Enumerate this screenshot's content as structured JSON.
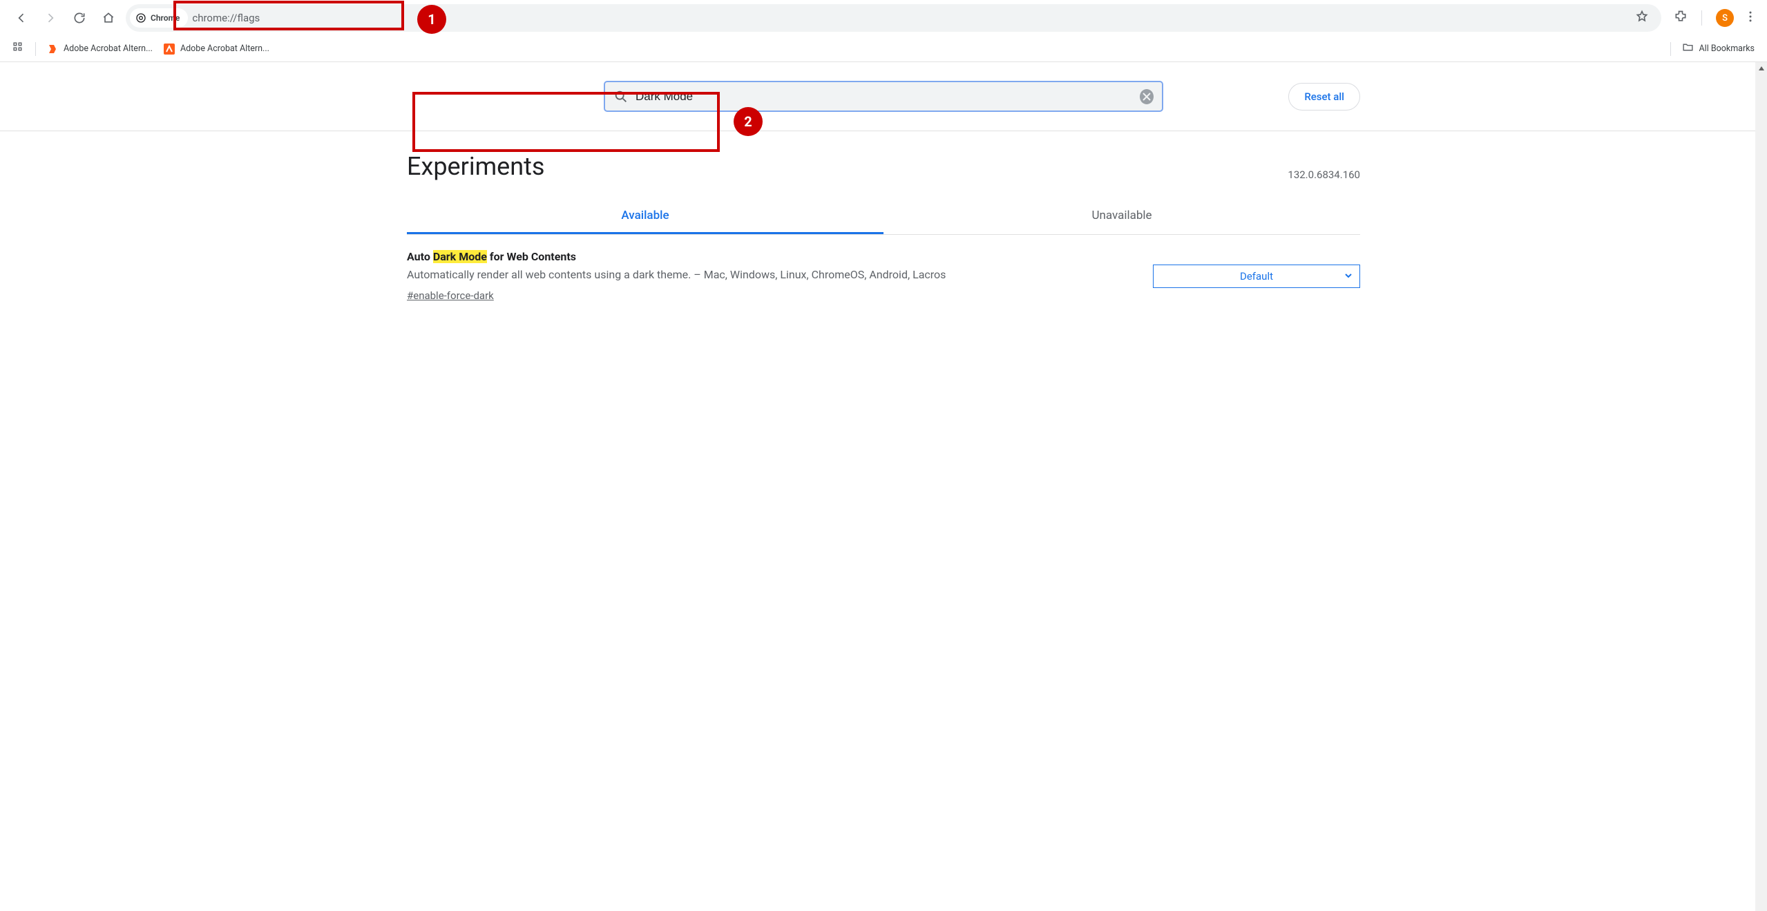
{
  "toolbar": {
    "chip_label": "Chrome",
    "url": "chrome://flags",
    "avatar_initial": "S"
  },
  "bookmarks": {
    "item1": "Adobe Acrobat Altern...",
    "item2": "Adobe Acrobat Altern...",
    "all_label": "All Bookmarks"
  },
  "annotations": {
    "badge1": "1",
    "badge2": "2"
  },
  "flags": {
    "search_value": "Dark Mode",
    "reset_label": "Reset all",
    "page_title": "Experiments",
    "version": "132.0.6834.160",
    "tab_available": "Available",
    "tab_unavailable": "Unavailable",
    "item": {
      "title_pre": "Auto ",
      "title_hl": "Dark Mode",
      "title_post": " for Web Contents",
      "desc": "Automatically render all web contents using a dark theme. – Mac, Windows, Linux, ChromeOS, Android, Lacros",
      "tag": "#enable-force-dark",
      "select_value": "Default"
    }
  }
}
